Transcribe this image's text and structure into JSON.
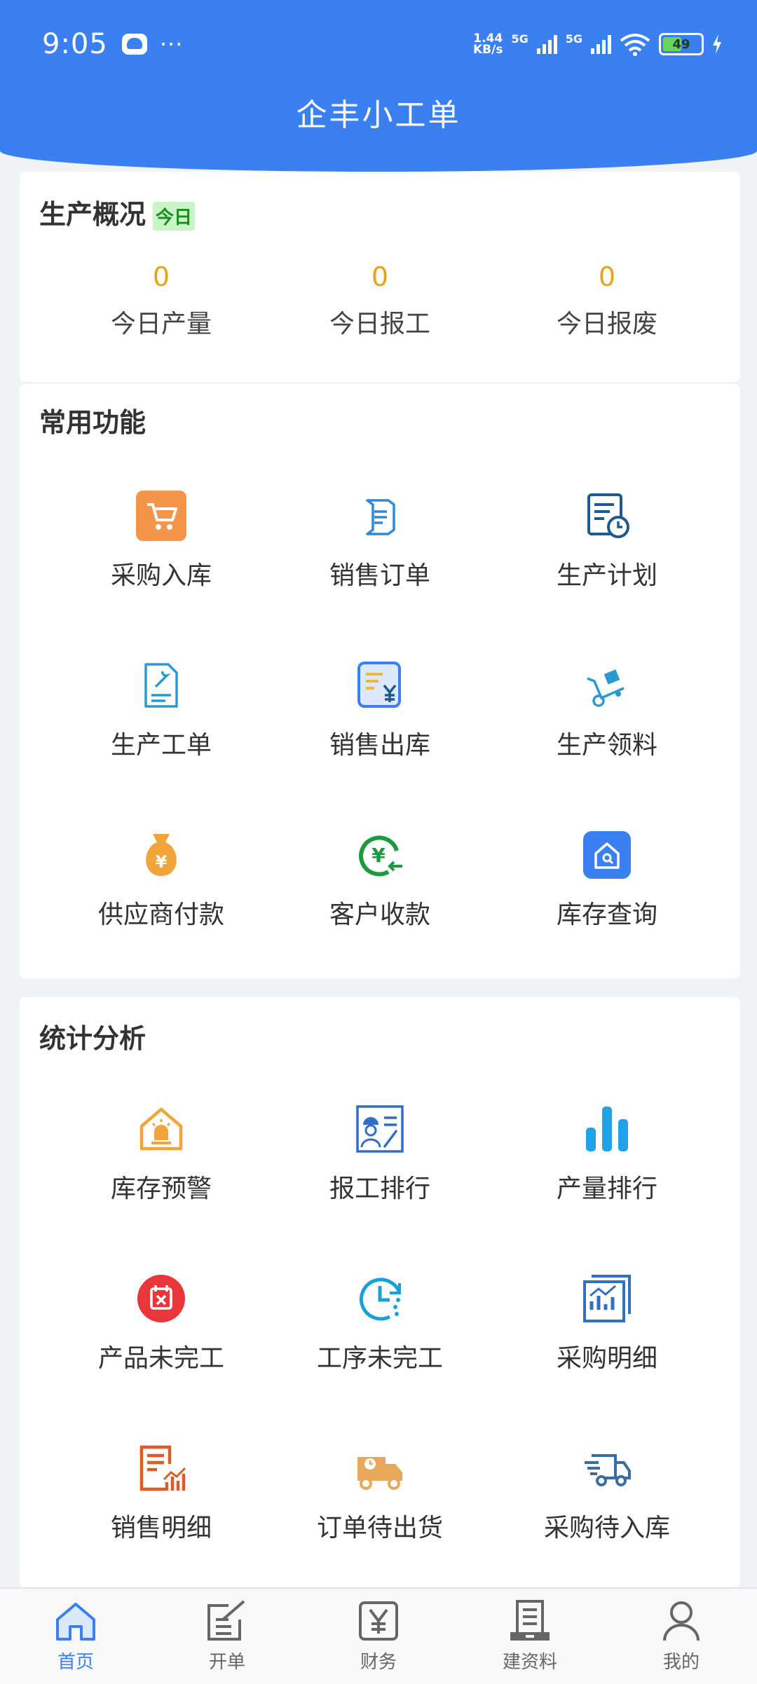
{
  "status_bar": {
    "time": "9:05",
    "dots": "···",
    "net_speed": "1.44\nKB/s",
    "net_speed_top": "1.44",
    "net_speed_bottom": "KB/s",
    "sim1": "5G",
    "sim2": "5G",
    "battery": "49"
  },
  "app": {
    "title": "企丰小工单"
  },
  "overview": {
    "title": "生产概况",
    "badge": "今日",
    "stats": [
      {
        "value": "0",
        "label": "今日产量"
      },
      {
        "value": "0",
        "label": "今日报工"
      },
      {
        "value": "0",
        "label": "今日报废"
      }
    ]
  },
  "common": {
    "title": "常用功能",
    "items": [
      {
        "label": "采购入库",
        "icon": "cart-icon"
      },
      {
        "label": "销售订单",
        "icon": "order-doc-icon"
      },
      {
        "label": "生产计划",
        "icon": "plan-clock-icon"
      },
      {
        "label": "生产工单",
        "icon": "workorder-icon"
      },
      {
        "label": "销售出库",
        "icon": "sales-out-icon"
      },
      {
        "label": "生产领料",
        "icon": "trolley-icon"
      },
      {
        "label": "供应商付款",
        "icon": "moneybag-icon"
      },
      {
        "label": "客户收款",
        "icon": "receive-money-icon"
      },
      {
        "label": "库存查询",
        "icon": "stock-search-icon"
      }
    ]
  },
  "analysis": {
    "title": "统计分析",
    "items": [
      {
        "label": "库存预警",
        "icon": "stock-alert-icon"
      },
      {
        "label": "报工排行",
        "icon": "worker-rank-icon"
      },
      {
        "label": "产量排行",
        "icon": "bar-chart-icon"
      },
      {
        "label": "产品未完工",
        "icon": "calendar-x-icon"
      },
      {
        "label": "工序未完工",
        "icon": "clock-dots-icon"
      },
      {
        "label": "采购明细",
        "icon": "purchase-detail-icon"
      },
      {
        "label": "销售明细",
        "icon": "sales-detail-icon"
      },
      {
        "label": "订单待出货",
        "icon": "delivery-truck-icon"
      },
      {
        "label": "采购待入库",
        "icon": "fast-truck-icon"
      }
    ]
  },
  "tabs": [
    {
      "label": "首页",
      "icon": "home-icon",
      "active": true
    },
    {
      "label": "开单",
      "icon": "edit-doc-icon"
    },
    {
      "label": "财务",
      "icon": "yen-icon"
    },
    {
      "label": "建资料",
      "icon": "archive-icon"
    },
    {
      "label": "我的",
      "icon": "user-icon"
    }
  ],
  "colors": {
    "primary": "#3a80f0",
    "stat_value": "#e8a418",
    "badge_bg": "#c8f4c8",
    "badge_text": "#1b8c1b"
  }
}
